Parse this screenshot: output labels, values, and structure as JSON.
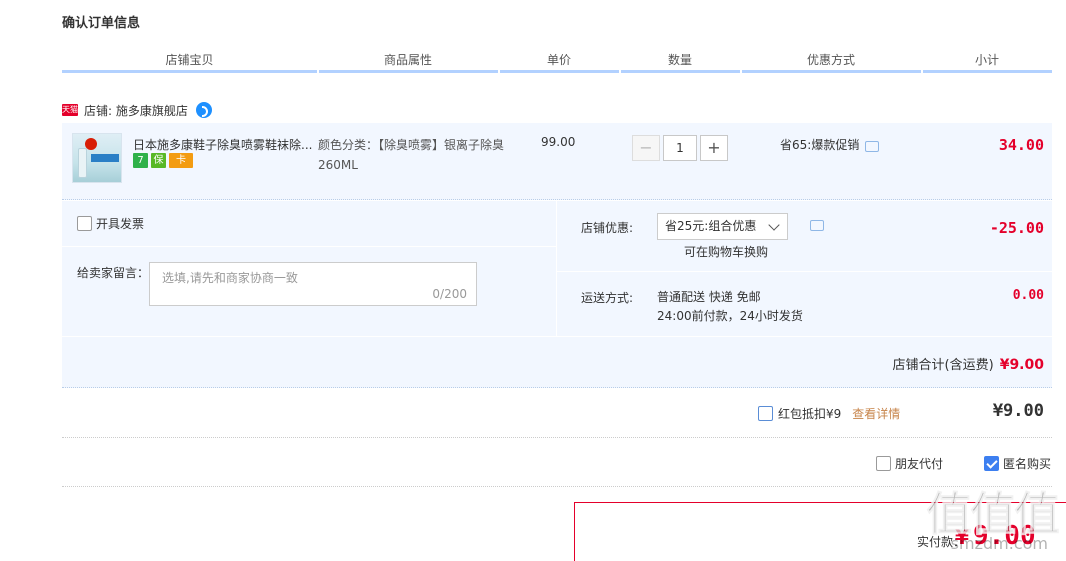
{
  "page": {
    "title": "确认订单信息"
  },
  "columns": [
    {
      "label": "店铺宝贝"
    },
    {
      "label": "商品属性"
    },
    {
      "label": "单价"
    },
    {
      "label": "数量"
    },
    {
      "label": "优惠方式"
    },
    {
      "label": "小计"
    }
  ],
  "store": {
    "badge": "天猫",
    "name": "店铺: 施多康旗舰店"
  },
  "item": {
    "title": "日本施多康鞋子除臭喷雾鞋袜除...",
    "service_icons": [
      "7",
      "保",
      "卡"
    ],
    "attribute": "颜色分类：【除臭喷雾】银离子除臭260ML",
    "unit_price": "99.00",
    "quantity": "1",
    "minus_label": "−",
    "plus_label": "+",
    "promotion": "省65:爆款促销",
    "subtotal": "34.00"
  },
  "invoice": {
    "label": "开具发票",
    "checked": false
  },
  "memo": {
    "label": "给卖家留言：",
    "placeholder": "选填,请先和商家协商一致",
    "counter": "0/200"
  },
  "store_coupon": {
    "label": "店铺优惠:",
    "selected": "省25元:组合优惠",
    "tip": "可在购物车换购",
    "amount": "-25.00"
  },
  "shipping": {
    "label": "运送方式:",
    "line1": "普通配送 快递 免邮",
    "line2": "24:00前付款，24小时发货",
    "fee": "0.00"
  },
  "store_total": {
    "label": "店铺合计(含运费)",
    "value": "¥9.00"
  },
  "red_packet": {
    "label": "红包抵扣¥9",
    "detail_link": "查看详情",
    "total": "¥9.00",
    "checked": false
  },
  "payment_options": {
    "friend_pay": {
      "label": "朋友代付",
      "checked": false
    },
    "anonymous": {
      "label": "匿名购买",
      "checked": true
    }
  },
  "final": {
    "label": "实付款：",
    "yen": "¥",
    "value": "9.00"
  },
  "watermark": {
    "big": "值值值",
    "small": "smzdm.com"
  },
  "colors": {
    "accent": "#e4002b",
    "header_bar": "#b2d1ff",
    "row_bg": "#f2f7ff",
    "checkbox_blue": "#3d7ff0"
  }
}
